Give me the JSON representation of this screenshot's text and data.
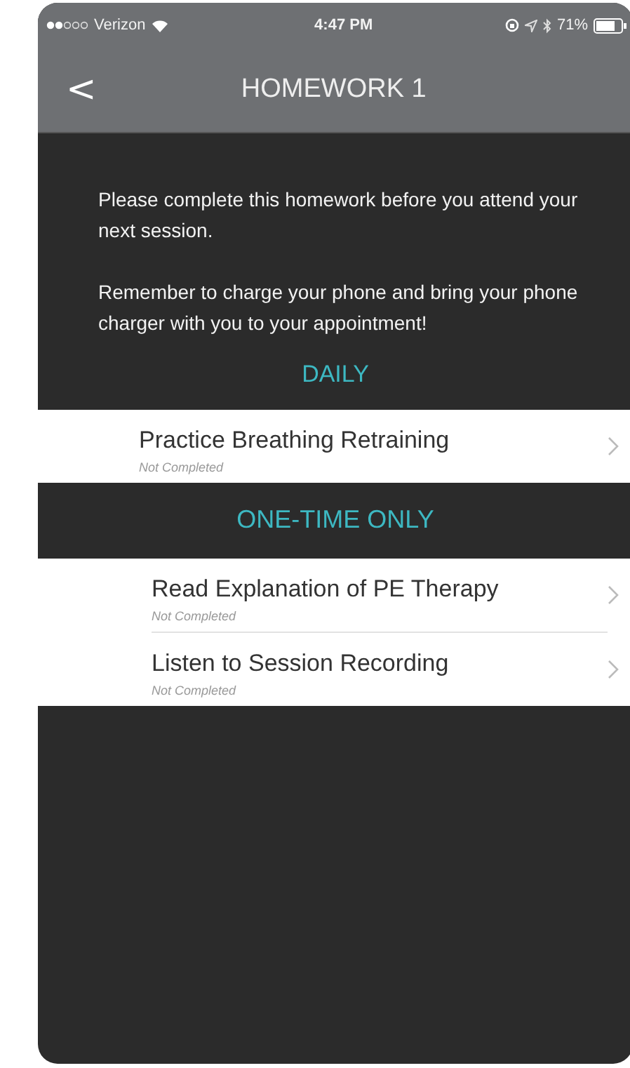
{
  "status_bar": {
    "carrier": "Verizon",
    "time": "4:47 PM",
    "battery": "71%"
  },
  "nav": {
    "back": "<",
    "title": "HOMEWORK 1"
  },
  "intro": [
    "Please complete this homework before you attend your next session.",
    "Remember to charge your phone and bring your phone charger with you to your appointment!"
  ],
  "sections": [
    {
      "title": "DAILY",
      "items": [
        {
          "title": "Practice Breathing Retraining",
          "status": "Not Completed"
        }
      ]
    },
    {
      "title": "ONE-TIME ONLY",
      "items": [
        {
          "title": "Read Explanation of PE Therapy",
          "status": "Not Completed"
        },
        {
          "title": "Listen to Session Recording",
          "status": "Not Completed"
        }
      ]
    }
  ]
}
